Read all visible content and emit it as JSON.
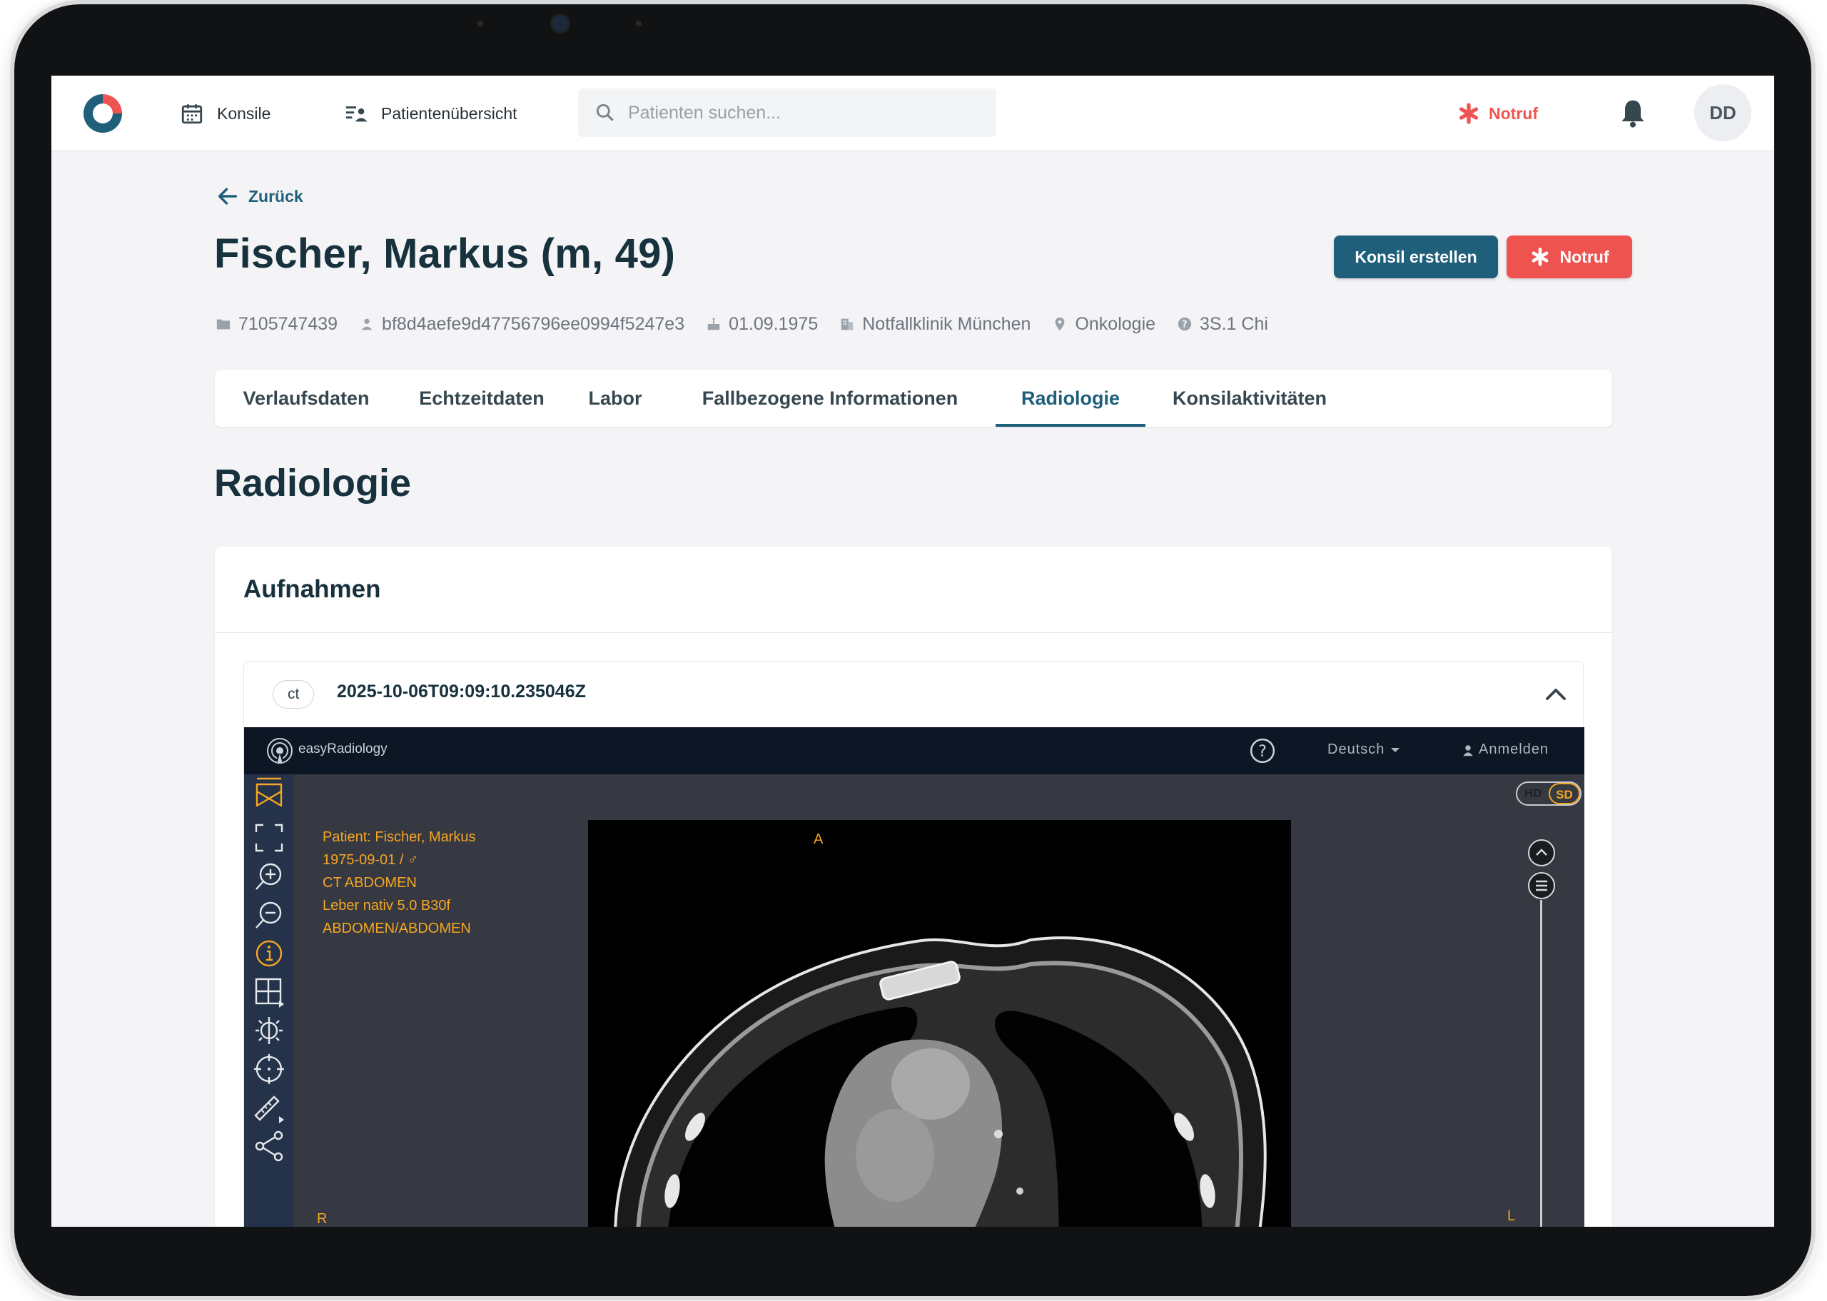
{
  "nav": {
    "konsile": "Konsile",
    "patientenuebersicht": "Patientenübersicht",
    "search_placeholder": "Patienten suchen...",
    "notruf": "Notruf",
    "avatar_initials": "DD"
  },
  "header": {
    "back": "Zurück",
    "patient_name": "Fischer, Markus (m, 49)",
    "btn_konsil": "Konsil erstellen",
    "btn_notruf": "Notruf"
  },
  "meta": {
    "case_id": "7105747439",
    "patient_hash": "bf8d4aefe9d47756796ee0994f5247e3",
    "birth_date": "01.09.1975",
    "clinic": "Notfallklinik München",
    "department": "Onkologie",
    "room": "3S.1 Chi"
  },
  "tabs": [
    {
      "label": "Verlaufsdaten"
    },
    {
      "label": "Echtzeitdaten"
    },
    {
      "label": "Labor"
    },
    {
      "label": "Fallbezogene Informationen"
    },
    {
      "label": "Radiologie",
      "active": true
    },
    {
      "label": "Konsilaktivitäten"
    }
  ],
  "section_title": "Radiologie",
  "card": {
    "title": "Aufnahmen",
    "study": {
      "modality": "ct",
      "datetime": "2025-10-06T09:09:10.235046Z"
    }
  },
  "viewer": {
    "brand": "easyRadiology",
    "language": "Deutsch",
    "login": "Anmelden",
    "hd": "HD",
    "sd": "SD",
    "overlay": [
      "Patient: Fischer, Markus",
      "1975-09-01 / ♂",
      "CT ABDOMEN",
      "Leber nativ 5.0 B30f",
      "ABDOMEN/ABDOMEN"
    ],
    "orientation": {
      "top": "A",
      "left": "R",
      "right": "L"
    }
  },
  "colors": {
    "primary": "#1f5f7a",
    "danger": "#ef5350",
    "viewer_accent": "#f5a623"
  }
}
